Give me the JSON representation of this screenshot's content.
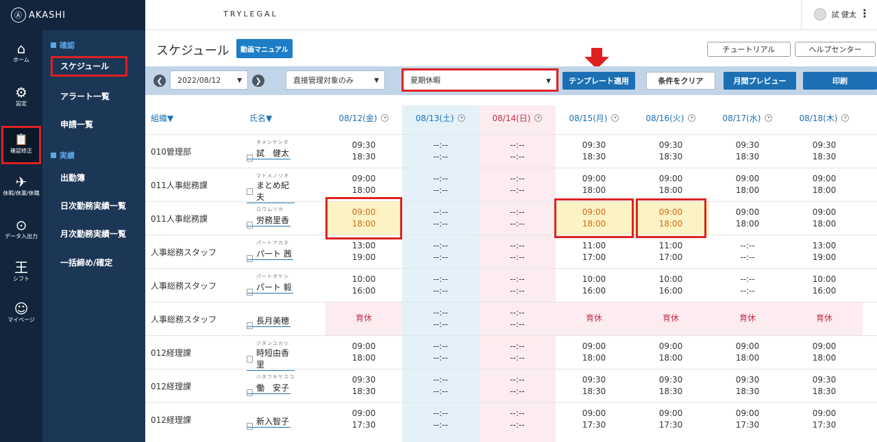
{
  "app": {
    "logo": "AKASHI",
    "brand": "TRYLEGAL",
    "user": "試 健太"
  },
  "rail": [
    {
      "label": "ホーム",
      "icon": "home-icon",
      "glyph": "⌂"
    },
    {
      "label": "設定",
      "icon": "gear-icon",
      "glyph": "⚙"
    },
    {
      "label": "確認修正",
      "icon": "clipboard-check-icon",
      "glyph": "📋"
    },
    {
      "label": "休暇/休業/休職",
      "icon": "plane-icon",
      "glyph": "✈"
    },
    {
      "label": "データ入出力",
      "icon": "download-icon",
      "glyph": "⊙"
    },
    {
      "label": "シフト",
      "icon": "shift-icon",
      "glyph": "王"
    },
    {
      "label": "マイページ",
      "icon": "user-icon",
      "glyph": "☺"
    }
  ],
  "submenu": {
    "section1": "確認",
    "section1_items": [
      "スケジュール",
      "アラート一覧",
      "申請一覧"
    ],
    "section2": "実績",
    "section2_items": [
      "出勤簿",
      "日次勤務実績一覧",
      "月次勤務実績一覧",
      "一括締め/確定"
    ]
  },
  "page": {
    "title": "スケジュール",
    "manual_btn": "動画マニュアル",
    "tutorial_btn": "チュートリアル",
    "help_btn": "ヘルプセンター"
  },
  "filters": {
    "date": "2022/08/12",
    "scope": "直接管理対象のみ",
    "template": "夏期休暇",
    "apply_btn": "テンプレート適用",
    "clear_btn": "条件をクリア",
    "preview_btn": "月間プレビュー",
    "print_btn": "印刷"
  },
  "columns": {
    "org": "組織▼",
    "name": "氏名▼",
    "dates": [
      "08/12(金)",
      "08/13(土)",
      "08/14(日)",
      "08/15(月)",
      "08/16(火)",
      "08/17(水)",
      "08/18(木)"
    ]
  },
  "colors": {
    "accent": "#1d7ec7",
    "highlight": "#e02020",
    "sunday": "#c3314b",
    "saturday": "#1d6fb3"
  },
  "rows": [
    {
      "org": "010管理部",
      "kana": "タメシケンタ",
      "name": "試　健太",
      "cells": [
        [
          "09:30",
          "18:30"
        ],
        [
          "--:--",
          "--:--"
        ],
        [
          "--:--",
          "--:--"
        ],
        [
          "09:30",
          "18:30"
        ],
        [
          "09:30",
          "18:30"
        ],
        [
          "09:30",
          "18:30"
        ],
        [
          "09:30",
          "18:30"
        ]
      ]
    },
    {
      "org": "011人事総務課",
      "kana": "マトメノリオ",
      "name": "まとめ紀夫",
      "cells": [
        [
          "09:00",
          "18:00"
        ],
        [
          "--:--",
          "--:--"
        ],
        [
          "--:--",
          "--:--"
        ],
        [
          "09:00",
          "18:00"
        ],
        [
          "09:00",
          "18:00"
        ],
        [
          "09:00",
          "18:00"
        ],
        [
          "09:00",
          "18:00"
        ]
      ]
    },
    {
      "org": "011人事総務課",
      "kana": "ロウムリカ",
      "name": "労務里香",
      "cells": [
        [
          "09:00",
          "18:00"
        ],
        [
          "--:--",
          "--:--"
        ],
        [
          "--:--",
          "--:--"
        ],
        [
          "09:00",
          "18:00"
        ],
        [
          "09:00",
          "18:00"
        ],
        [
          "09:00",
          "18:00"
        ],
        [
          "09:00",
          "18:00"
        ]
      ]
    },
    {
      "org": "人事総務スタッフ",
      "kana": "パートアカネ",
      "name": "パート 茜",
      "cells": [
        [
          "13:00",
          "19:00"
        ],
        [
          "--:--",
          "--:--"
        ],
        [
          "--:--",
          "--:--"
        ],
        [
          "11:00",
          "17:00"
        ],
        [
          "11:00",
          "17:00"
        ],
        [
          "--:--",
          "--:--"
        ],
        [
          "13:00",
          "19:00"
        ]
      ]
    },
    {
      "org": "人事総務スタッフ",
      "kana": "パートタケシ",
      "name": "パート 毅",
      "cells": [
        [
          "10:00",
          "16:00"
        ],
        [
          "--:--",
          "--:--"
        ],
        [
          "--:--",
          "--:--"
        ],
        [
          "10:00",
          "16:00"
        ],
        [
          "10:00",
          "16:00"
        ],
        [
          "--:--",
          "--:--"
        ],
        [
          "10:00",
          "16:00"
        ]
      ]
    },
    {
      "org": "人事総務スタッフ",
      "kana": "",
      "name": "長月美穂",
      "cells": [
        [
          "育休"
        ],
        [
          "--:--",
          "--:--"
        ],
        [
          "--:--",
          "--:--"
        ],
        [
          "育休"
        ],
        [
          "育休"
        ],
        [
          "育休"
        ],
        [
          "育休"
        ]
      ]
    },
    {
      "org": "012経理課",
      "kana": "ジタンユカリ",
      "name": "時短由香里",
      "cells": [
        [
          "09:00",
          "18:00"
        ],
        [
          "--:--",
          "--:--"
        ],
        [
          "--:--",
          "--:--"
        ],
        [
          "09:00",
          "18:00"
        ],
        [
          "09:00",
          "18:00"
        ],
        [
          "09:00",
          "18:00"
        ],
        [
          "09:00",
          "18:00"
        ]
      ]
    },
    {
      "org": "012経理課",
      "kana": "ハタラキヤスコ",
      "name": "働　安子",
      "cells": [
        [
          "09:30",
          "18:30"
        ],
        [
          "--:--",
          "--:--"
        ],
        [
          "--:--",
          "--:--"
        ],
        [
          "09:30",
          "18:30"
        ],
        [
          "09:30",
          "18:30"
        ],
        [
          "09:30",
          "18:30"
        ],
        [
          "09:30",
          "18:30"
        ]
      ]
    },
    {
      "org": "012経理課",
      "kana": "",
      "name": "新入智子",
      "cells": [
        [
          "09:00",
          "17:30"
        ],
        [
          "--:--",
          "--:--"
        ],
        [
          "--:--",
          "--:--"
        ],
        [
          "09:00",
          "17:30"
        ],
        [
          "09:00",
          "17:30"
        ],
        [
          "09:00",
          "17:30"
        ],
        [
          "09:00",
          "17:30"
        ]
      ]
    }
  ]
}
